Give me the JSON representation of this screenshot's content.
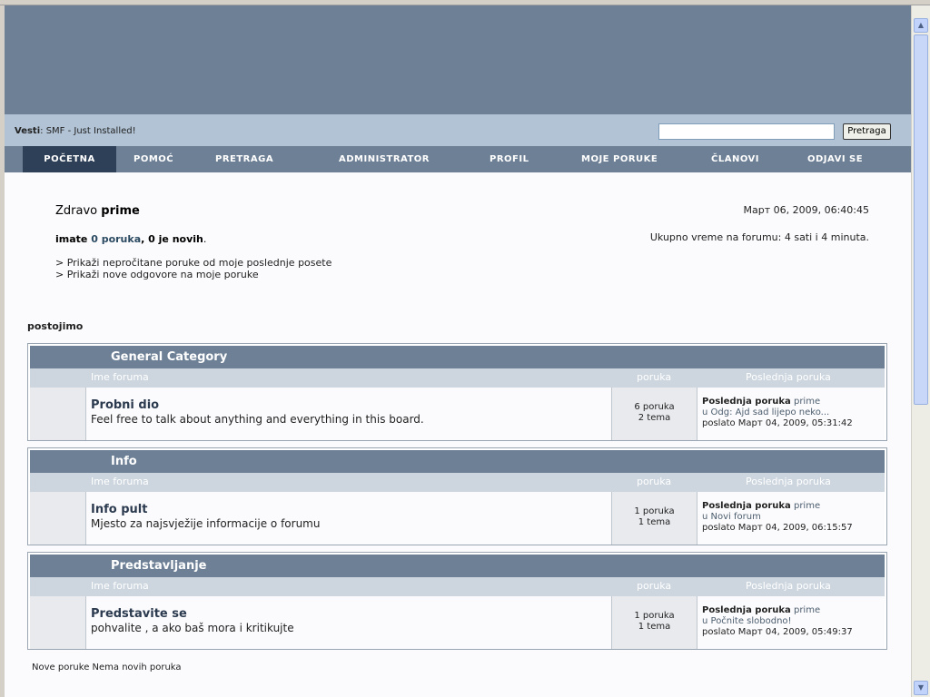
{
  "news": {
    "label": "Vesti",
    "text": "SMF - Just Installed!"
  },
  "search": {
    "button_label": "Pretraga",
    "value": ""
  },
  "menu": [
    {
      "label": "POČETNA",
      "active": true
    },
    {
      "label": "POMOĆ"
    },
    {
      "label": "PRETRAGA"
    },
    {
      "label": "ADMINISTRATOR"
    },
    {
      "label": "PROFIL"
    },
    {
      "label": "MOJE PORUKE"
    },
    {
      "label": "ČLANOVI"
    },
    {
      "label": "ODJAVI SE"
    }
  ],
  "user": {
    "greeting": "Zdravo",
    "name": "prime",
    "messages_prefix": "imate",
    "messages_link": "0 poruka",
    "messages_suffix": ", 0 je novih",
    "messages_end": "."
  },
  "date": "Март 06, 2009, 06:40:45",
  "total_time": "Ukupno vreme na forumu: 4 sati i 4 minuta.",
  "quick_links": [
    "> Prikaži nepročitane poruke od moje poslednje posete",
    "> Prikaži nove odgovore na moje poruke"
  ],
  "online_title": "postojimo",
  "columns": {
    "forum": "Ime foruma",
    "posts": "poruka",
    "last": "Poslednja poruka"
  },
  "categories": [
    {
      "title": "General Category",
      "forum": {
        "name": "Probni dio",
        "description": "Feel free to talk about anything and everything in this board.",
        "posts": "6 poruka",
        "topics": "2 tema",
        "last_label": "Poslednja poruka",
        "last_user": "prime",
        "last_topic": "u Odg: Ajd sad lijepo neko...",
        "last_date": "poslato Март 04, 2009, 05:31:42"
      }
    },
    {
      "title": "Info",
      "forum": {
        "name": "Info pult",
        "description": "Mjesto za najsvježije informacije o forumu",
        "posts": "1 poruka",
        "topics": "1 tema",
        "last_label": "Poslednja poruka",
        "last_user": "prime",
        "last_topic": "u Novi forum",
        "last_date": "poslato Март 04, 2009, 06:15:57"
      }
    },
    {
      "title": "Predstavljanje",
      "forum": {
        "name": "Predstavite se",
        "description": "pohvalite , a ako baš mora i kritikujte",
        "posts": "1 poruka",
        "topics": "1 tema",
        "last_label": "Poslednja poruka",
        "last_user": "prime",
        "last_topic": "u Počnite slobodno!",
        "last_date": "poslato Март 04, 2009, 05:49:37"
      }
    }
  ],
  "legend": "Nove poruke Nema novih poruka"
}
